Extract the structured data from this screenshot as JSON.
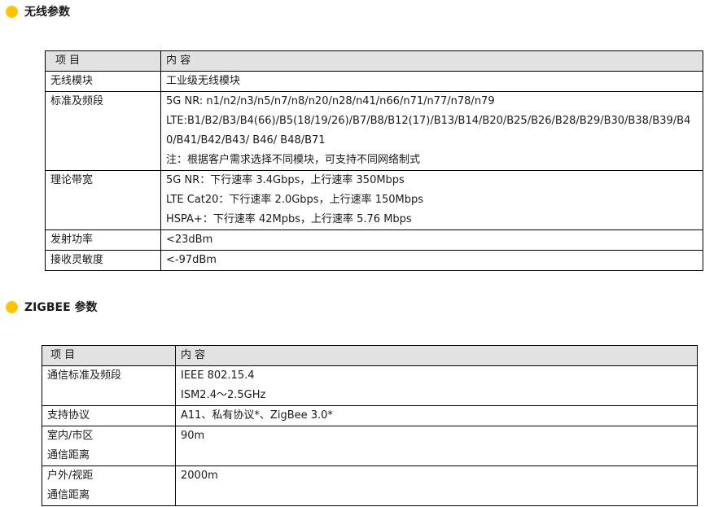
{
  "wireless": {
    "title": "无线参数",
    "header": {
      "col1": "项  目",
      "col2": "内    容"
    },
    "rows": [
      {
        "label": "无线模块",
        "lines": [
          "工业级无线模块"
        ]
      },
      {
        "label": "标准及频段",
        "lines": [
          "5G NR: n1/n2/n3/n5/n7/n8/n20/n28/n41/n66/n71/n77/n78/n79",
          "LTE:B1/B2/B3/B4(66)/B5(18/19/26)/B7/B8/B12(17)/B13/B14/B20/B25/B26/B28/B29/B30/B38/B39/B40/B41/B42/B43/ B46/ B48/B71",
          "注：根据客户需求选择不同模块，可支持不同网络制式"
        ]
      },
      {
        "label": "理论带宽",
        "lines": [
          "5G NR：下行速率 3.4Gbps，上行速率 350Mbps",
          "LTE Cat20：下行速率 2.0Gbps，上行速率 150Mbps",
          "HSPA+：下行速率 42Mpbs，上行速率 5.76 Mbps"
        ]
      },
      {
        "label": "发射功率",
        "lines": [
          "<23dBm"
        ]
      },
      {
        "label": "接收灵敏度",
        "lines": [
          "<-97dBm"
        ]
      }
    ]
  },
  "zigbee": {
    "title": "ZIGBEE 参数",
    "header": {
      "col1": "项  目",
      "col2": "内    容"
    },
    "rows": [
      {
        "label": "通信标准及频段",
        "lines": [
          "IEEE 802.15.4",
          "ISM2.4～2.5GHz"
        ]
      },
      {
        "label": "支持协议",
        "lines": [
          "A11、私有协议*、ZigBee 3.0*"
        ]
      },
      {
        "label_lines": [
          "室内/市区",
          "通信距离"
        ],
        "lines": [
          "90m"
        ]
      },
      {
        "label_lines": [
          "户外/视距",
          "通信距离"
        ],
        "lines": [
          "2000m"
        ]
      }
    ]
  }
}
